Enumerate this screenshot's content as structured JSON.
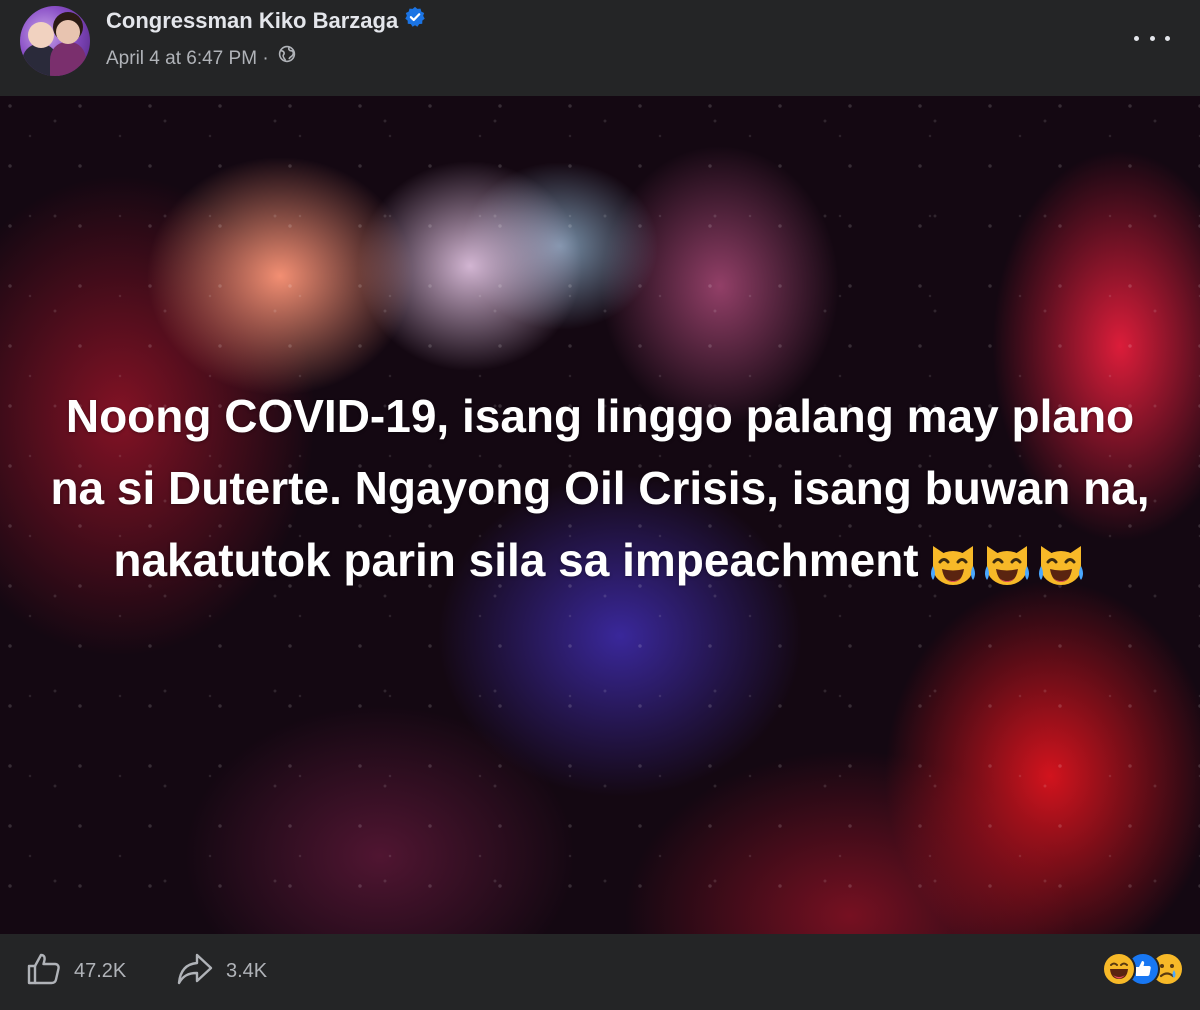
{
  "post": {
    "author": "Congressman Kiko Barzaga",
    "verified": true,
    "timestamp": "April 4 at 6:47 PM",
    "separator": "·",
    "audience_icon": "globe-icon",
    "more_icon": "more-options-icon",
    "text": "Noong COVID-19, isang linggo palang may plano na si Duterte. Ngayong Oil Crisis, isang buwan na, nakatutok parin sila sa impeachment",
    "text_emojis": [
      "crying-laughing-cat-emoji",
      "crying-laughing-cat-emoji",
      "crying-laughing-cat-emoji"
    ]
  },
  "footer": {
    "like_count": "47.2K",
    "share_count": "3.4K",
    "like_icon": "thumbs-up-icon",
    "share_icon": "share-arrow-icon",
    "reactions": [
      "haha-reaction-icon",
      "like-reaction-icon",
      "sad-reaction-icon"
    ]
  },
  "colors": {
    "background": "#242526",
    "primary_text": "#e4e6eb",
    "secondary_text": "#b0b3b8",
    "verified_blue": "#1b74e4",
    "like_blue": "#1877f2",
    "reaction_yellow": "#f7b928"
  }
}
